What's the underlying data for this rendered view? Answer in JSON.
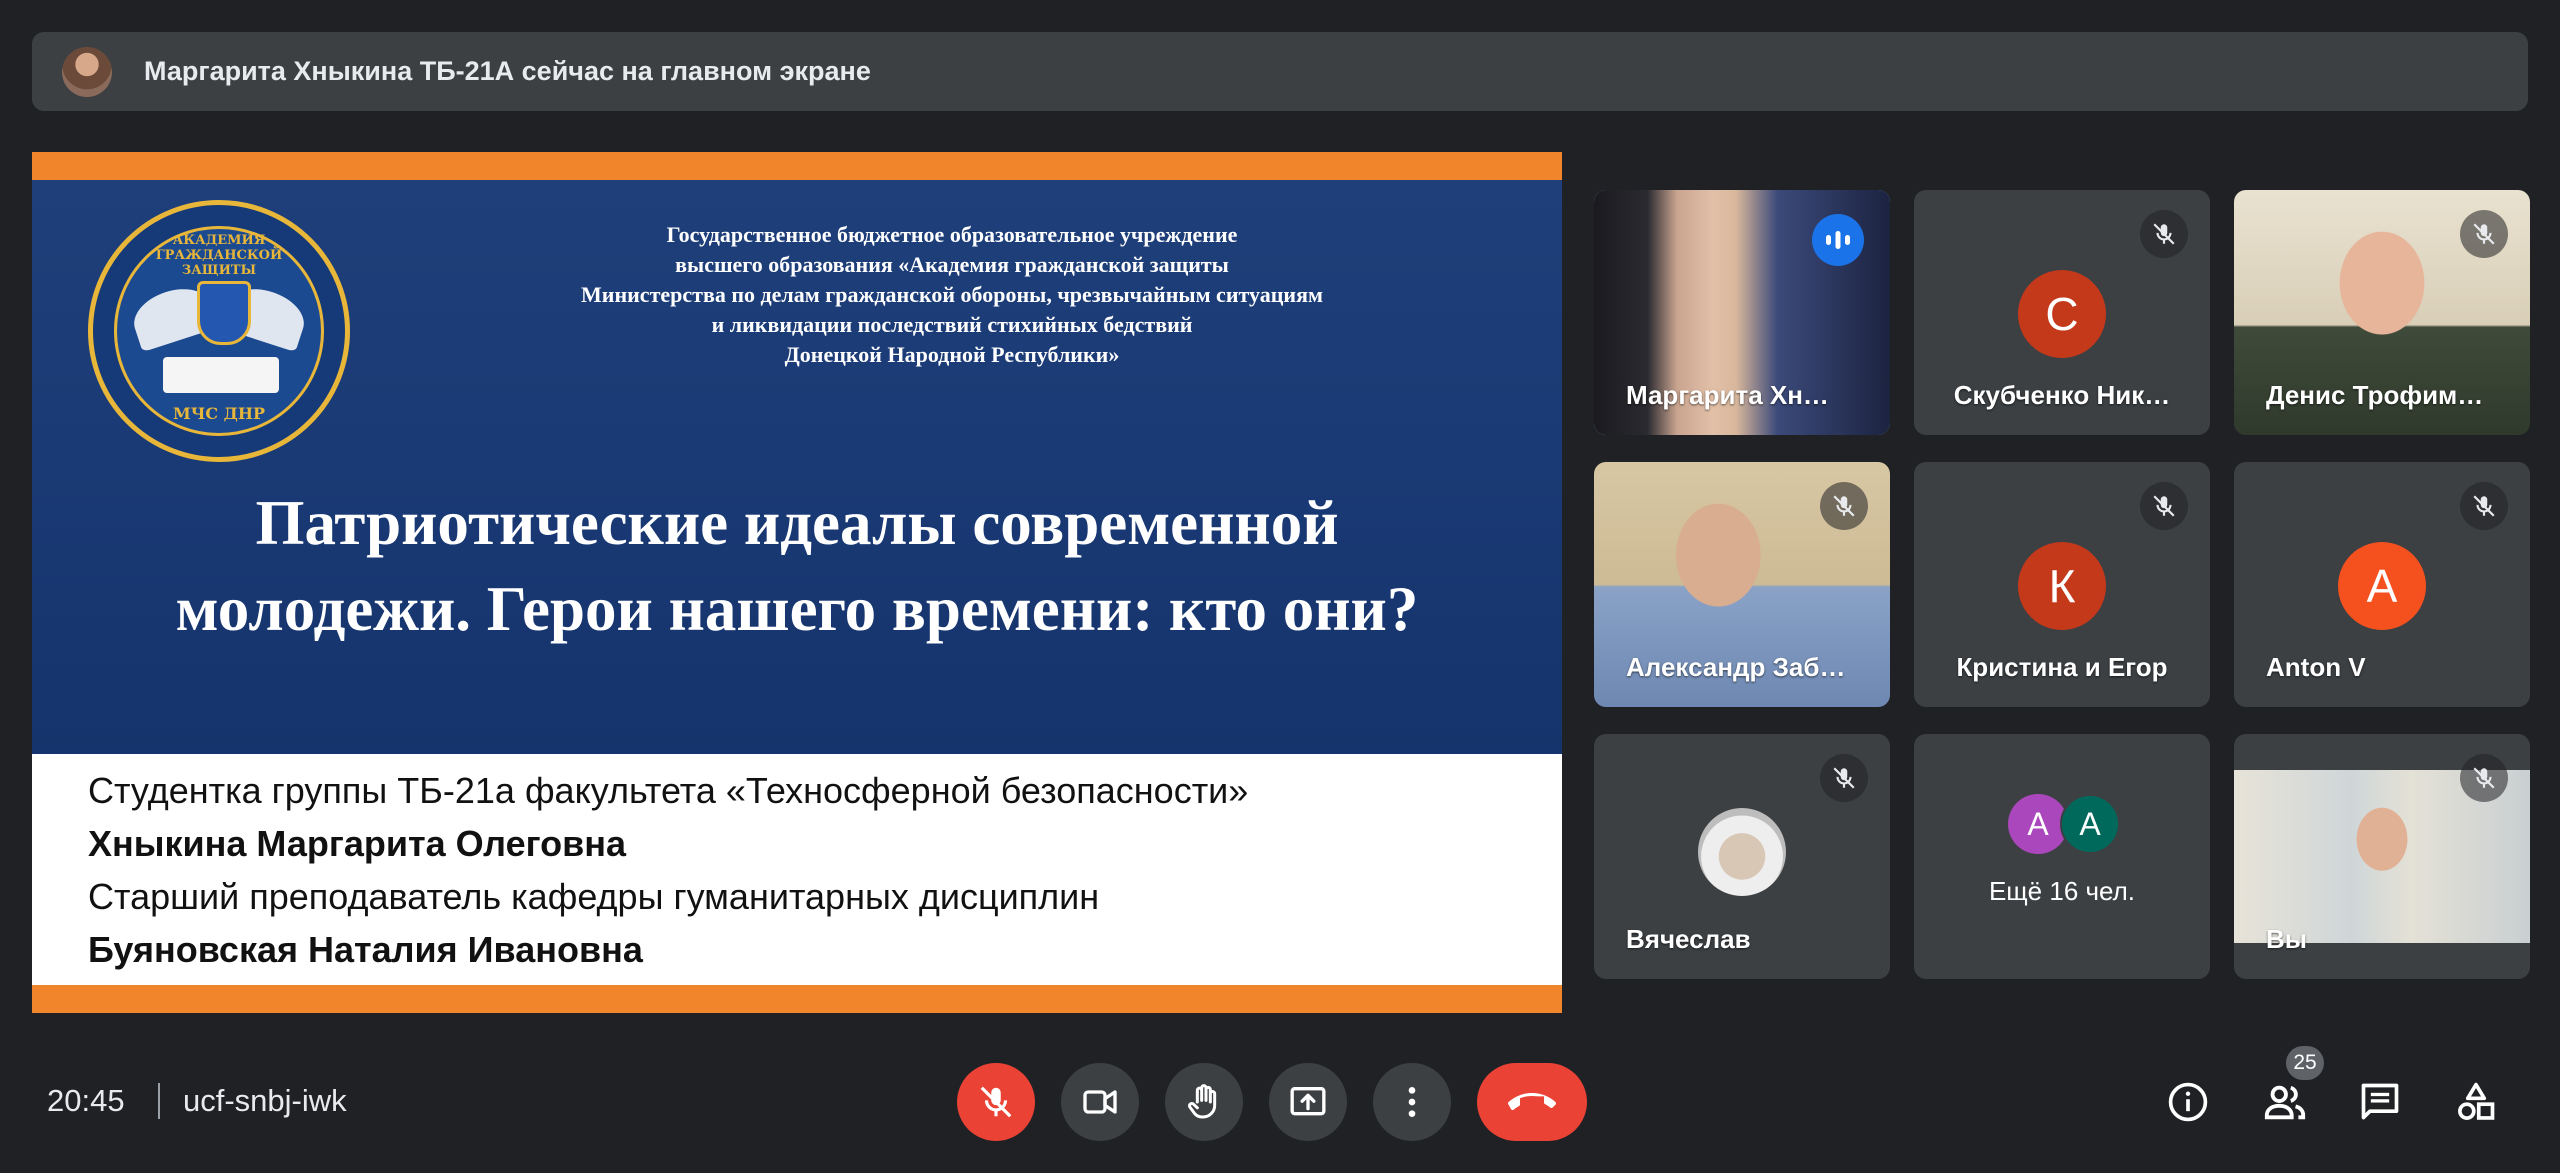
{
  "banner": {
    "text": "Маргарита Хныкина ТБ-21А сейчас на главном экране"
  },
  "slide": {
    "emblem_top": "АКАДЕМИЯ ГРАЖДАНСКОЙ ЗАЩИТЫ",
    "emblem_bottom": "МЧС ДНР",
    "org_lines": [
      "Государственное бюджетное образовательное учреждение",
      "высшего образования «Академия гражданской защиты",
      "Министерства по делам гражданской обороны, чрезвычайным ситуациям",
      "и ликвидации последствий стихийных бедствий",
      "Донецкой Народной Республики»"
    ],
    "title": "Патриотические идеалы современной молодежи. Герои нашего времени: кто они?",
    "authors": [
      "Студентка группы ТБ-21а факультета «Техносферной безопасности»",
      "Хныкина Маргарита Олеговна",
      "Старший преподаватель кафедры гуманитарных дисциплин",
      "Буяновская Наталия Ивановна"
    ]
  },
  "participants": [
    {
      "name": "Маргарита Хн…",
      "type": "video",
      "speaking": true
    },
    {
      "name": "Скубченко Ник…",
      "type": "letter",
      "letter": "С",
      "color": "#c5391b",
      "muted": true
    },
    {
      "name": "Денис Трофим…",
      "type": "video",
      "muted": true
    },
    {
      "name": "Александр Заб…",
      "type": "video",
      "muted": true
    },
    {
      "name": "Кристина и Егор",
      "type": "letter",
      "letter": "К",
      "color": "#c5391b",
      "muted": true
    },
    {
      "name": "Anton V",
      "type": "letter",
      "letter": "A",
      "color": "#f4511e",
      "muted": true
    },
    {
      "name": "Вячеслав",
      "type": "avatar",
      "muted": true
    },
    {
      "name": "Ещё 16 чел.",
      "type": "more",
      "letters": [
        "A",
        "A"
      ],
      "colors": [
        "#ab47bc",
        "#00695c"
      ]
    },
    {
      "name": "Вы",
      "type": "video",
      "muted": true
    }
  ],
  "footer": {
    "time": "20:45",
    "meeting_code": "ucf-snbj-iwk",
    "people_count": "25"
  },
  "icons": {
    "mic_off": "mic-off-icon",
    "camera": "videocam-icon",
    "raise_hand": "hand-icon",
    "present": "present-screen-icon",
    "more": "more-vert-icon",
    "end_call": "call-end-icon",
    "info": "info-icon",
    "people": "people-icon",
    "chat": "chat-icon",
    "activities": "activities-icon"
  }
}
